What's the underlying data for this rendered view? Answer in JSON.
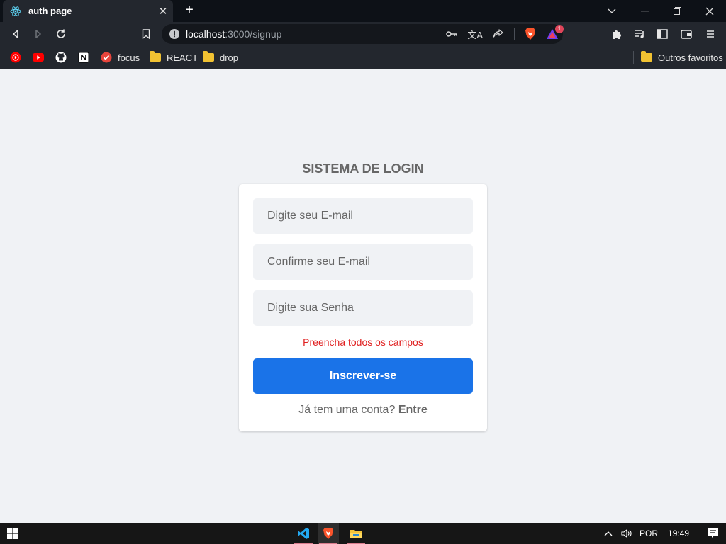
{
  "browser": {
    "tab_title": "auth page",
    "tab_close": "✕",
    "new_tab": "+",
    "url_host": "localhost",
    "url_path": ":3000/signup",
    "bookmarks": [
      {
        "label": "",
        "icon": "music-icon"
      },
      {
        "label": "",
        "icon": "youtube-icon"
      },
      {
        "label": "",
        "icon": "github-icon"
      },
      {
        "label": "",
        "icon": "notion-icon"
      },
      {
        "label": "focus",
        "icon": "checkmark-icon"
      },
      {
        "label": "REACT",
        "icon": "folder-icon"
      },
      {
        "label": "drop",
        "icon": "folder-icon"
      }
    ],
    "other_bookmarks": "Outros favoritos",
    "alerts_badge": "1"
  },
  "page": {
    "title": "SISTEMA DE LOGIN",
    "email_placeholder": "Digite seu E-mail",
    "email_confirm_placeholder": "Confirme seu E-mail",
    "password_placeholder": "Digite sua Senha",
    "error_message": "Preencha todos os campos",
    "submit_label": "Inscrever-se",
    "signin_prompt": "Já tem uma conta?",
    "signin_link": "Entre"
  },
  "taskbar": {
    "apps": [
      "vscode-icon",
      "brave-icon",
      "file-explorer-icon"
    ],
    "language": "POR",
    "time": "19:49"
  },
  "colors": {
    "primary": "#1a73e8",
    "error": "#e02020",
    "page_background": "#f0f2f5"
  }
}
